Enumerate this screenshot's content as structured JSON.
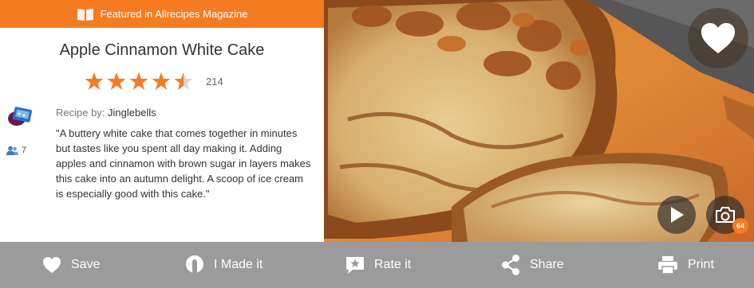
{
  "banner": {
    "text": "Featured in Allrecipes Magazine",
    "icon": "magazine-icon"
  },
  "recipe": {
    "title": "Apple Cinnamon White Cake",
    "rating": {
      "stars": 4.5,
      "max": 5,
      "count": "214"
    },
    "byline_label": "Recipe by:",
    "author": "Jinglebells",
    "made_count": "7",
    "description": "\"A buttery white cake that comes together in minutes but tastes like you spent all day making it. Adding apples and cinnamon with brown sugar in layers makes this cake into an autumn delight. A scoop of ice cream is especially good with this cake.\""
  },
  "photo": {
    "photo_count": "64"
  },
  "actions": [
    {
      "label": "Save",
      "icon": "heart-icon"
    },
    {
      "label": "I Made it",
      "icon": "made-it-icon"
    },
    {
      "label": "Rate it",
      "icon": "rate-star-icon"
    },
    {
      "label": "Share",
      "icon": "share-icon"
    },
    {
      "label": "Print",
      "icon": "printer-icon"
    }
  ],
  "colors": {
    "accent": "#f47b20",
    "action_bar": "#9b9b9b",
    "text": "#333333"
  }
}
